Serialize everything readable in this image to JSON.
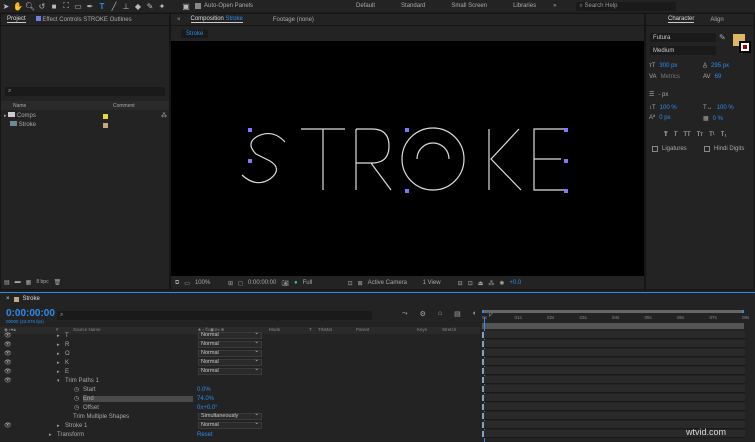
{
  "toolbar": {
    "auto_open_label": "Auto-Open Panels",
    "workspaces": [
      "Default",
      "Standard",
      "Small Screen",
      "Libraries"
    ],
    "search_placeholder": "Search Help"
  },
  "project": {
    "tab": "Project",
    "effect_tab": "Effect Controls STROKE Outlines",
    "columns": {
      "name": "Name",
      "comment": "Comment"
    },
    "items": [
      {
        "name": "Comps",
        "color": "#e5d63a"
      },
      {
        "name": "Stroke",
        "color": "#c6a77f"
      }
    ],
    "bpc": "8 bpc"
  },
  "composition": {
    "tab_prefix": "Composition",
    "tab_name": "Stroke",
    "footage_tab": "Footage (none)",
    "subtab": "Stroke",
    "text": "STROKE",
    "zoom": "100%",
    "timecode": "0:00:00:00",
    "resolution": "Full",
    "camera": "Active Camera",
    "view": "1 View",
    "exposure": "+0.0"
  },
  "character": {
    "tab": "Character",
    "align_tab": "Align",
    "font": "Futura",
    "style": "Medium",
    "size": "300 px",
    "leading": "295 px",
    "kerning": "Metrics",
    "tracking": "69",
    "stroke_width": "- px",
    "vscale": "100 %",
    "hscale": "100 %",
    "baseline": "0 px",
    "tsume": "0 %",
    "type_buttons": [
      "T",
      "T",
      "TT",
      "Tт",
      "T¹",
      "T₁"
    ],
    "ligatures": "Ligatures",
    "hindi": "Hindi Digits",
    "fill_color": "#e0b764"
  },
  "timeline": {
    "tab": "Stroke",
    "timecode": "0:00:00:00",
    "frames": "00000 (23.976 fps)",
    "columns": {
      "num": "#",
      "source": "Source Name",
      "mode": "Mode",
      "t": "T",
      "trkmat": "TrkMat",
      "parent": "Parent",
      "keys": "Keys",
      "stretch": "Stretch"
    },
    "rows": [
      {
        "name": "T",
        "mode": "Normal",
        "type": "layer"
      },
      {
        "name": "R",
        "mode": "Normal",
        "type": "layer"
      },
      {
        "name": "O",
        "mode": "Normal",
        "type": "layer"
      },
      {
        "name": "K",
        "mode": "Normal",
        "type": "layer"
      },
      {
        "name": "E",
        "mode": "Normal",
        "type": "layer"
      },
      {
        "name": "Trim Paths 1",
        "type": "group"
      },
      {
        "name": "Start",
        "value": "0.0%",
        "type": "prop"
      },
      {
        "name": "End",
        "value": "74.0%",
        "type": "prop"
      },
      {
        "name": "Offset",
        "value": "0x+0.0°",
        "type": "prop"
      },
      {
        "name": "Trim Multiple Shapes",
        "mode": "Simultaneously",
        "type": "opt"
      },
      {
        "name": "Stroke 1",
        "mode": "Normal",
        "type": "layer"
      },
      {
        "name": "Transform",
        "value": "Reset",
        "type": "tf"
      }
    ],
    "ruler": [
      "0s",
      "01s",
      "02s",
      "03s",
      "04s",
      "05s",
      "06s",
      "07s",
      "08s"
    ]
  },
  "watermark": "wtvid.com"
}
